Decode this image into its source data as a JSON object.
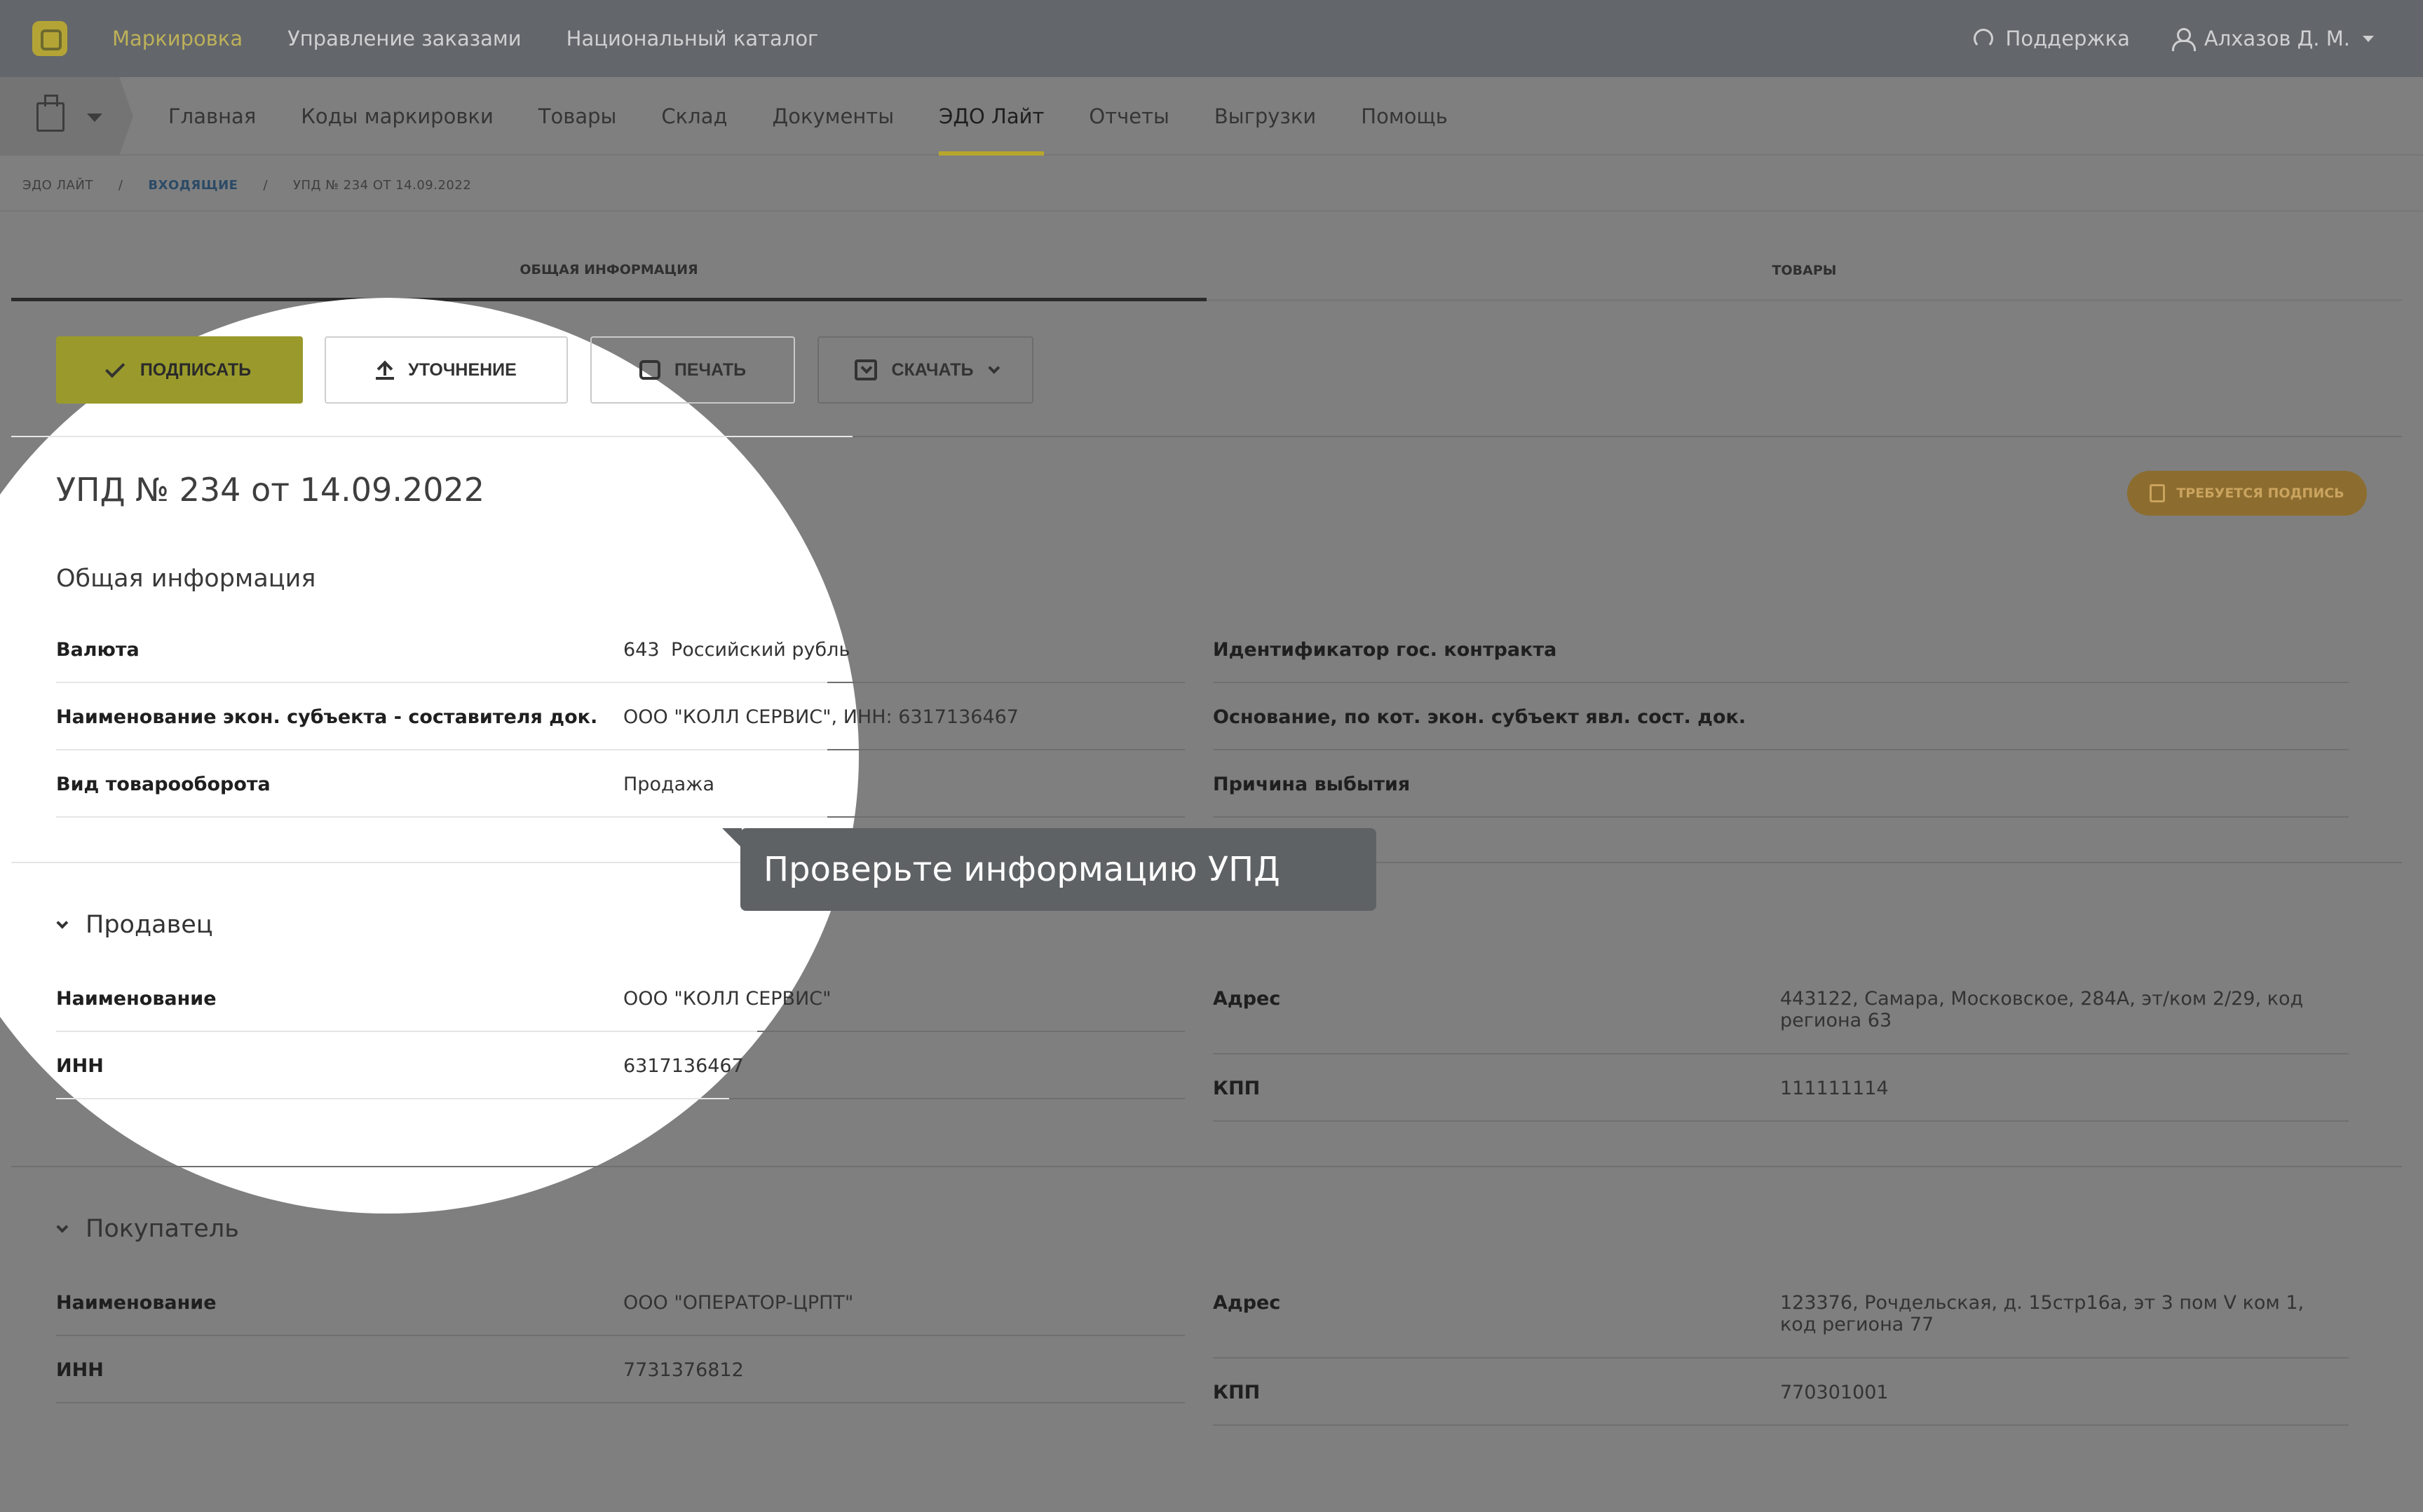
{
  "topbar": {
    "nav": [
      "Маркировка",
      "Управление заказами",
      "Национальный каталог"
    ],
    "support": "Поддержка",
    "user": "Алхазов Д. М."
  },
  "subnav": {
    "tabs": [
      "Главная",
      "Коды маркировки",
      "Товары",
      "Склад",
      "Документы",
      "ЭДО Лайт",
      "Отчеты",
      "Выгрузки",
      "Помощь"
    ],
    "active": "ЭДО Лайт"
  },
  "breadcrumb": [
    "ЭДО ЛАЙТ",
    "ВХОДЯЩИЕ",
    "УПД № 234 ОТ 14.09.2022"
  ],
  "doc_tabs": [
    "ОБЩАЯ ИНФОРМАЦИЯ",
    "ТОВАРЫ"
  ],
  "actions": {
    "sign": "ПОДПИСАТЬ",
    "clarify": "УТОЧНЕНИЕ",
    "print": "ПЕЧАТЬ",
    "download": "СКАЧАТЬ"
  },
  "document": {
    "title": "УПД № 234 от 14.09.2022",
    "status": "ТРЕБУЕТСЯ ПОДПИСЬ"
  },
  "general": {
    "title": "Общая информация",
    "currency_label": "Валюта",
    "currency_code": "643",
    "currency_name": "Российский рубль",
    "entity_label": "Наименование экон. субъекта - составителя док.",
    "entity_value": "ООО \"КОЛЛ СЕРВИС\", ИНН: 6317136467",
    "turnover_label": "Вид товарооборота",
    "turnover_value": "Продажа",
    "contract_label": "Идентификатор гос. контракта",
    "basis_label": "Основание, по кот. экон. субъект явл. сост. док.",
    "withdrawal_label": "Причина выбытия"
  },
  "seller": {
    "title": "Продавец",
    "name_label": "Наименование",
    "name_value": "ООО \"КОЛЛ СЕРВИС\"",
    "inn_label": "ИНН",
    "inn_value": "6317136467",
    "address_label": "Адрес",
    "address_value": "443122, Самара, Московское, 284А, эт/ком 2/29, код региона 63",
    "kpp_label": "КПП",
    "kpp_value": "111111114"
  },
  "buyer": {
    "title": "Покупатель",
    "name_label": "Наименование",
    "name_value": "ООО \"ОПЕРАТОР-ЦРПТ\"",
    "inn_label": "ИНН",
    "inn_value": "7731376812",
    "address_label": "Адрес",
    "address_value": "123376, Рочдельская, д. 15стр16а, эт 3 пом V ком 1, код региона 77",
    "kpp_label": "КПП",
    "kpp_value": "770301001"
  },
  "tooltip": "Проверьте информацию УПД"
}
